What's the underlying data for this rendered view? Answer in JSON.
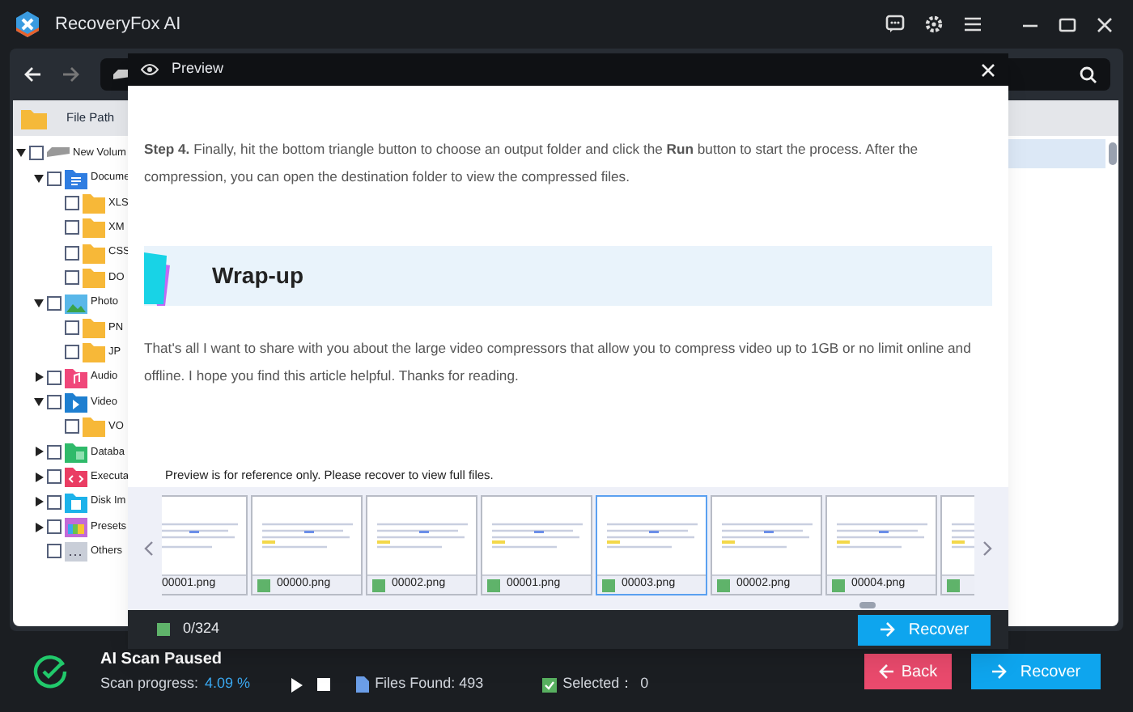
{
  "window": {
    "title": "RecoveryFox AI"
  },
  "tree": {
    "header": "File Path",
    "items": [
      {
        "label": "New Volum",
        "kind": "drive",
        "checked": false,
        "expanded": true,
        "children": [
          {
            "label": "Docume",
            "kind": "documents",
            "checked": false,
            "expanded": true,
            "children": [
              {
                "label": "XLS",
                "kind": "folder",
                "checked": false
              },
              {
                "label": "XM",
                "kind": "folder",
                "checked": false
              },
              {
                "label": "CSS",
                "kind": "folder",
                "checked": false
              },
              {
                "label": "DO",
                "kind": "folder",
                "checked": false
              }
            ]
          },
          {
            "label": "Photo",
            "kind": "photo",
            "checked": false,
            "expanded": true,
            "children": [
              {
                "label": "PN",
                "kind": "folder",
                "checked": false
              },
              {
                "label": "JP",
                "kind": "folder",
                "checked": false
              }
            ]
          },
          {
            "label": "Audio",
            "kind": "audio",
            "checked": false,
            "expanded": false
          },
          {
            "label": "Video",
            "kind": "video",
            "checked": false,
            "expanded": true,
            "children": [
              {
                "label": "VO",
                "kind": "folder",
                "checked": false
              }
            ]
          },
          {
            "label": "Databa",
            "kind": "database",
            "checked": false,
            "expanded": false
          },
          {
            "label": "Executa",
            "kind": "executable",
            "checked": false,
            "expanded": false
          },
          {
            "label": "Disk Im",
            "kind": "disk",
            "checked": false,
            "expanded": false
          },
          {
            "label": "Presets",
            "kind": "presets",
            "checked": false,
            "expanded": false
          },
          {
            "label": "Others",
            "kind": "others",
            "checked": false
          }
        ]
      }
    ]
  },
  "preview": {
    "title": "Preview",
    "paragraphs": [
      "**Step 4.** Finally, hit the bottom triangle button to choose an output folder and click the **Run** button to start the process. After the compression, you can open the destination folder to view the compressed files."
    ],
    "heading": "Wrap-up",
    "closing": "That's all I want to share with you about the large video compressors that allow you to compress video up to 1GB or no limit online and offline. I hope you find this article helpful. Thanks for reading.",
    "notice": "Preview is for reference only. Please recover to view full files.",
    "thumbnails": [
      {
        "label": "00001.png",
        "selected": false
      },
      {
        "label": "00000.png",
        "selected": false
      },
      {
        "label": "00002.png",
        "selected": false
      },
      {
        "label": "00001.png",
        "selected": false
      },
      {
        "label": "00003.png",
        "selected": true
      },
      {
        "label": "00002.png",
        "selected": false
      },
      {
        "label": "00004.png",
        "selected": false
      },
      {
        "selected": false
      }
    ],
    "count": "0/324",
    "recover": "Recover"
  },
  "status": {
    "title": "AI Scan Paused",
    "progress_label": "Scan progress:",
    "progress_value": "4.09 %",
    "files_found": "Files Found: 493",
    "selected_label": "Selected：",
    "selected_value": "0"
  },
  "buttons": {
    "back": "Back",
    "recover": "Recover"
  }
}
